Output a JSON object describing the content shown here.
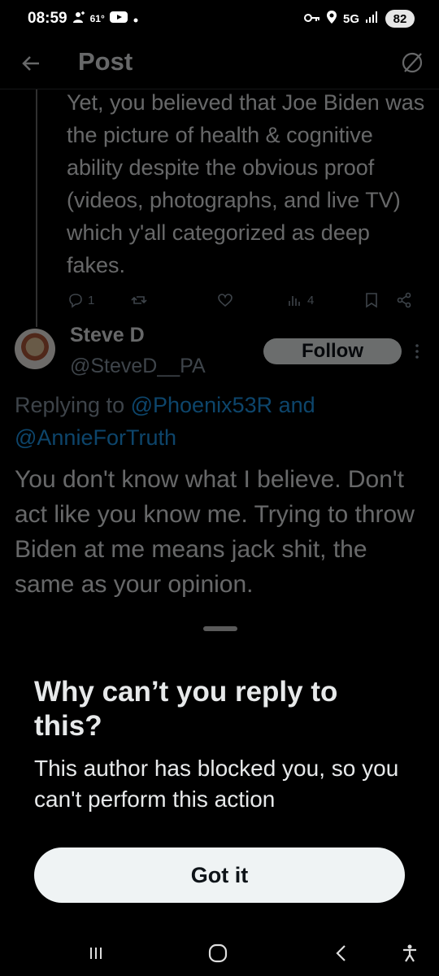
{
  "status_bar": {
    "time": "08:59",
    "temp": "61°",
    "network": "5G",
    "battery": "82"
  },
  "header": {
    "title": "Post",
    "back_icon": "arrow-left-icon",
    "right_icon": "no-symbol-icon"
  },
  "parent_tweet": {
    "text": "Yet, you believed that Joe Biden was the picture of health & cognitive ability despite the obvious proof (videos, photographs, and live TV) which y'all categorized as deep fakes.",
    "reply_count": "1",
    "view_count": "4"
  },
  "reply": {
    "author_name": "Steve D",
    "author_handle": "@SteveD__PA",
    "follow_label": "Follow",
    "replying_prefix": "Replying to",
    "mention_1": "@Phoenix53R",
    "and_word": "and",
    "mention_2": "@AnnieForTruth",
    "body": "You don't know what I believe. Don't act like you know me. Trying to throw Biden at me means jack shit, the same as your opinion."
  },
  "sheet": {
    "title": "Why can’t you reply to this?",
    "message": "This author has blocked you, so you can't perform this action",
    "button_label": "Got it"
  },
  "colors": {
    "background": "#000000",
    "text": "#e7e9ea",
    "muted": "#8b98a5",
    "link": "#1d9bf0",
    "button_bg": "#eff3f4"
  }
}
